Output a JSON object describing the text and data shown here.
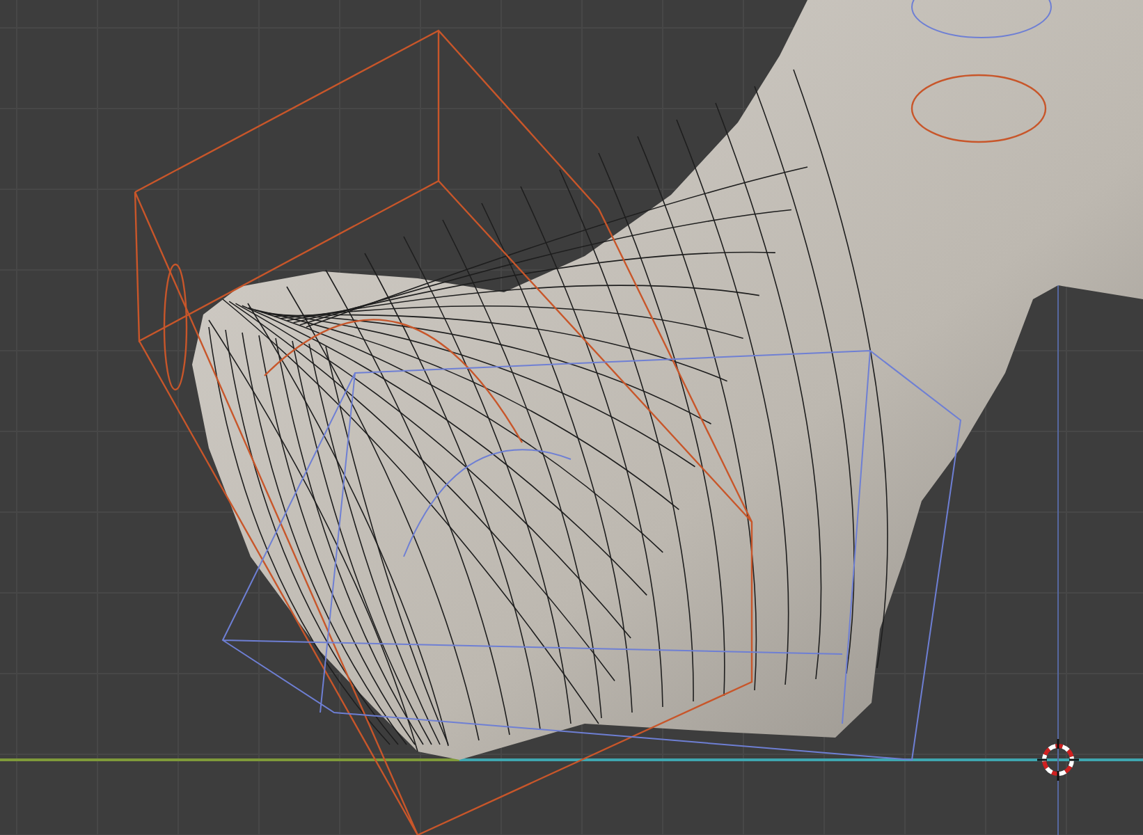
{
  "viewport": {
    "grid_visible": true,
    "cursor_visible": true,
    "wireframe_visible": true
  }
}
